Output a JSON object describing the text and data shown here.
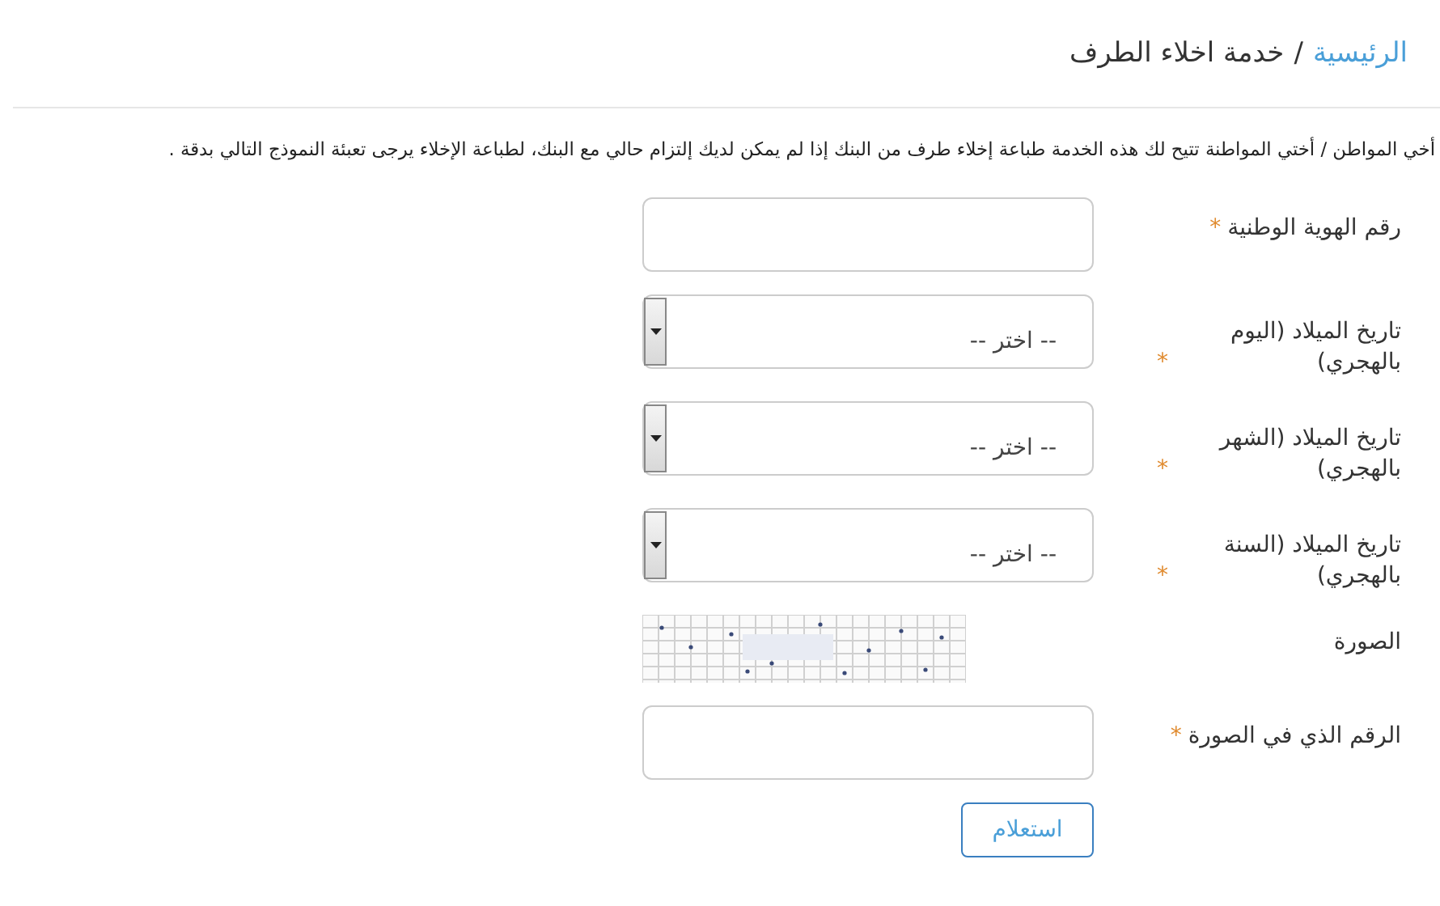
{
  "breadcrumb": {
    "home": "الرئيسية",
    "separator": "/",
    "current": "خدمة اخلاء الطرف"
  },
  "intro": "أخي المواطن / أختي المواطنة تتيح لك هذه الخدمة طباعة إخلاء طرف من البنك إذا لم يمكن لديك إلتزام حالي مع البنك، لطباعة الإخلاء يرجى تعبئة النموذج التالي بدقة .",
  "required_mark": "*",
  "fields": [
    {
      "kind": "text",
      "label": "رقم الهوية الوطنية",
      "required": true
    },
    {
      "kind": "select",
      "label": "تاريخ الميلاد (اليوم بالهجري)",
      "required": true,
      "value": "-- اختر --"
    },
    {
      "kind": "select",
      "label": "تاريخ الميلاد (الشهر بالهجري)",
      "required": true,
      "value": "-- اختر --"
    },
    {
      "kind": "select",
      "label": "تاريخ الميلاد (السنة بالهجري)",
      "required": true,
      "value": "-- اختر --"
    },
    {
      "kind": "captcha",
      "label": "الصورة",
      "required": false
    },
    {
      "kind": "text",
      "label": "الرقم الذي في الصورة",
      "required": true
    }
  ],
  "submit": "استعلام"
}
